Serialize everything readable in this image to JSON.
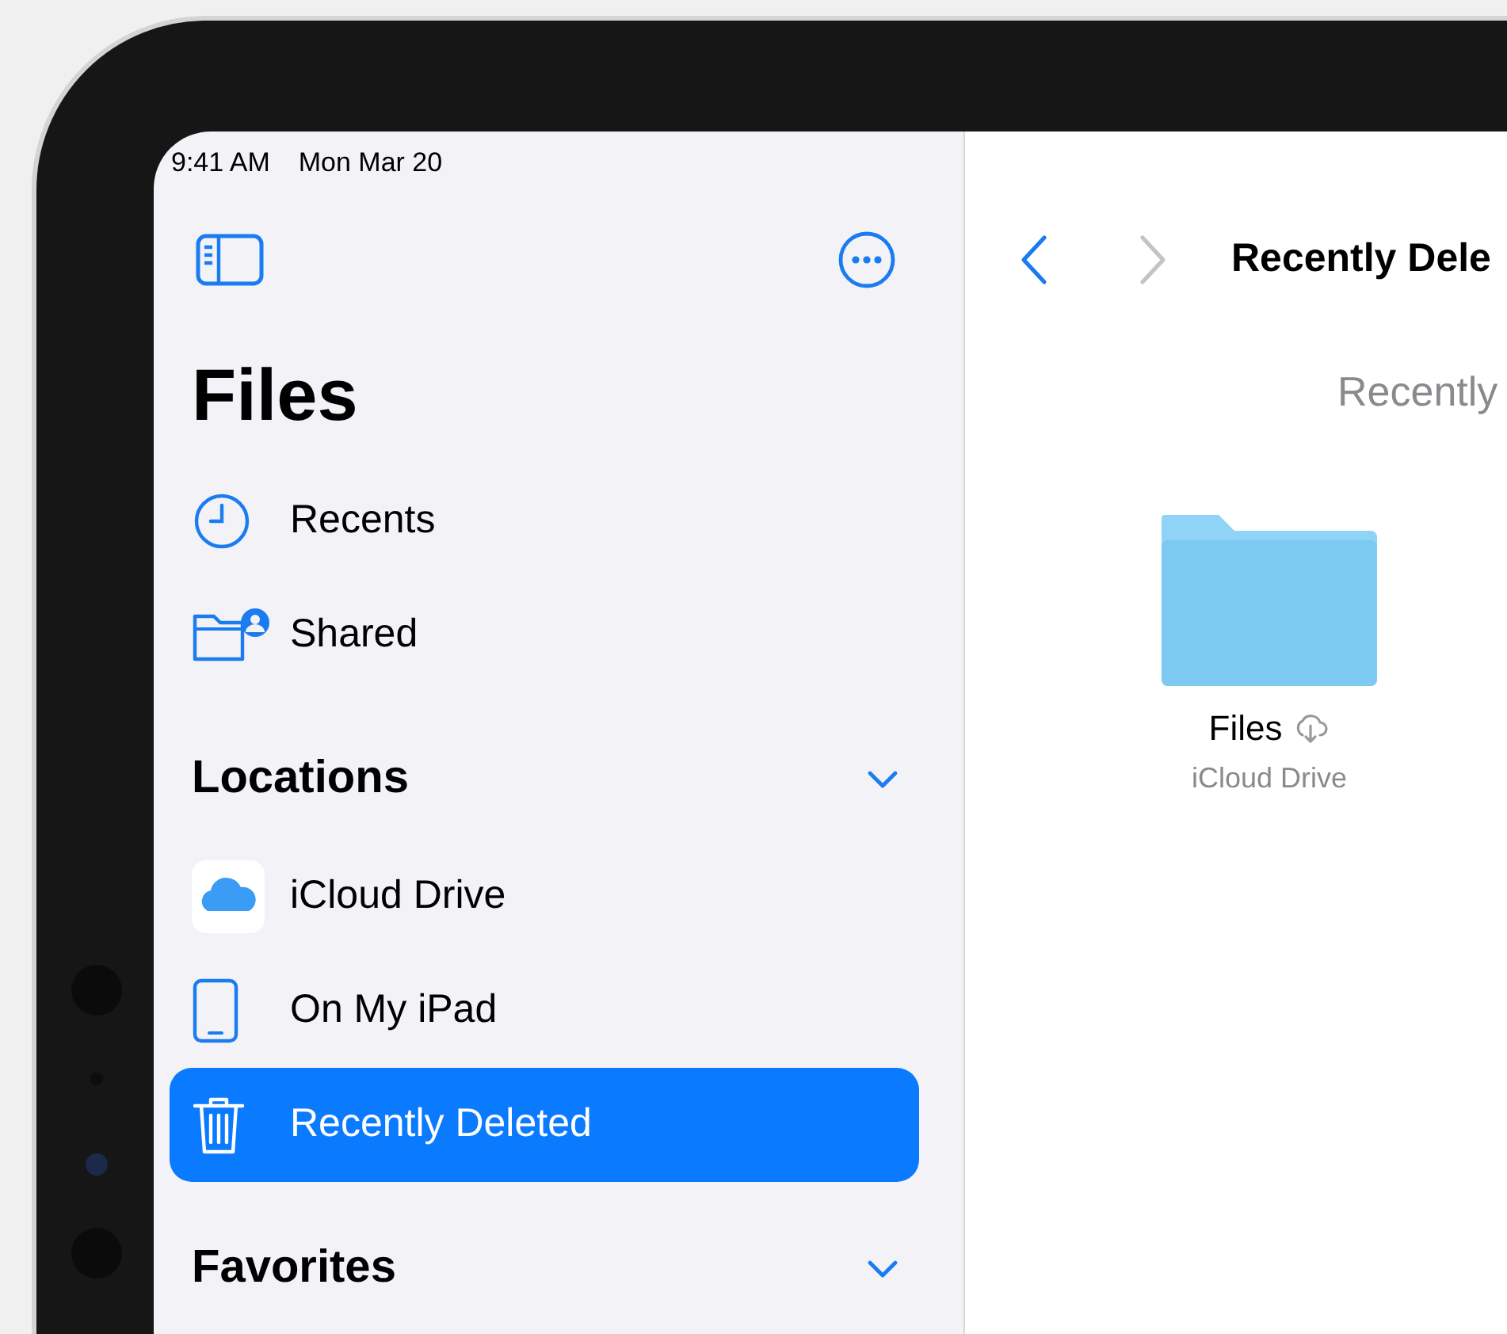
{
  "status_bar": {
    "time": "9:41 AM",
    "date": "Mon Mar 20"
  },
  "sidebar": {
    "title": "Files",
    "items": [
      {
        "label": "Recents",
        "kind": "clock",
        "selected": false
      },
      {
        "label": "Shared",
        "kind": "shared-folder",
        "selected": false
      }
    ],
    "sections": [
      {
        "title": "Locations",
        "expanded": true,
        "items": [
          {
            "label": "iCloud Drive",
            "kind": "cloud",
            "selected": false
          },
          {
            "label": "On My iPad",
            "kind": "ipad",
            "selected": false
          },
          {
            "label": "Recently Deleted",
            "kind": "trash",
            "selected": true
          }
        ]
      },
      {
        "title": "Favorites",
        "expanded": true
      }
    ]
  },
  "detail": {
    "nav": {
      "back_enabled": true,
      "forward_enabled": false
    },
    "title": "Recently Dele",
    "heading": "Recently",
    "items": [
      {
        "name": "Files",
        "location": "iCloud Drive",
        "in_cloud": true
      }
    ]
  }
}
